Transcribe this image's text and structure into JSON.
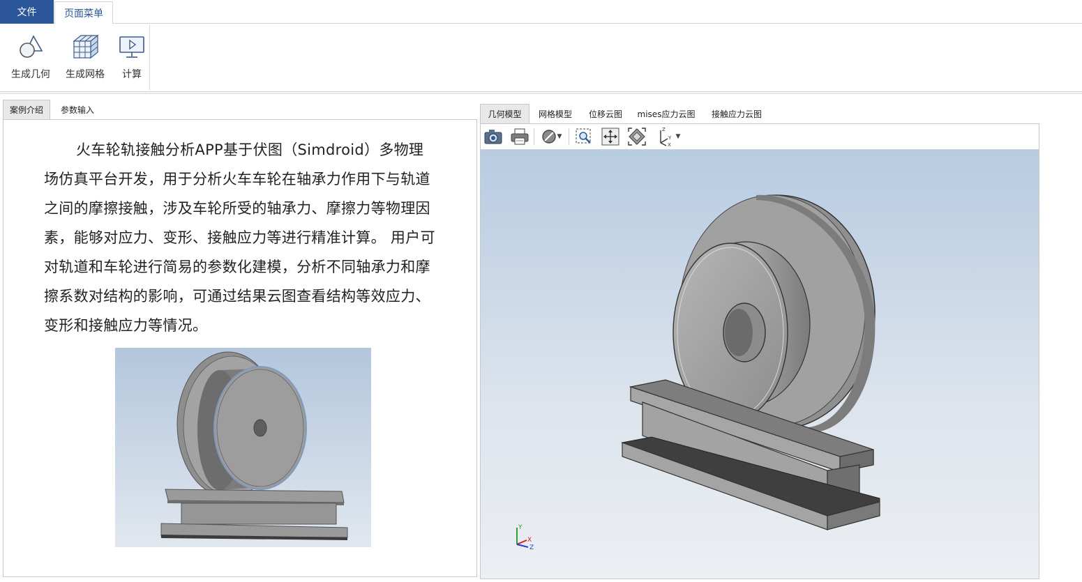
{
  "menubar": {
    "file_label": "文件",
    "page_menu_label": "页面菜单"
  },
  "ribbon": {
    "buttons": [
      {
        "label": "生成几何",
        "icon": "geometry-icon"
      },
      {
        "label": "生成网格",
        "icon": "mesh-icon"
      },
      {
        "label": "计算",
        "icon": "compute-icon"
      }
    ]
  },
  "left_tabs": [
    {
      "label": "案例介绍",
      "active": true
    },
    {
      "label": "参数输入",
      "active": false
    }
  ],
  "intro_text": "火车轮轨接触分析APP基于伏图（Simdroid）多物理场仿真平台开发，用于分析火车车轮在轴承力作用下与轨道之间的摩擦接触，涉及车轮所受的轴承力、摩擦力等物理因素，能够对应力、变形、接触应力等进行精准计算。 用户可对轨道和车轮进行简易的参数化建模，分析不同轴承力和摩擦系数对结构的影响，可通过结果云图查看结构等效应力、变形和接触应力等情况。",
  "right_tabs": [
    {
      "label": "几何模型",
      "active": true
    },
    {
      "label": "网格模型",
      "active": false
    },
    {
      "label": "位移云图",
      "active": false
    },
    {
      "label": "mises应力云图",
      "active": false
    },
    {
      "label": "接触应力云图",
      "active": false
    }
  ],
  "viewer_toolbar": {
    "icons": [
      "camera-icon",
      "print-icon",
      "render-style-icon",
      "zoom-box-icon",
      "pan-icon",
      "fit-view-icon",
      "axis-view-icon"
    ]
  },
  "axis_triad": {
    "x": "X",
    "y": "Y",
    "z": "Z"
  },
  "colors": {
    "accent": "#2b579a",
    "model_gray": "#9a9a9a",
    "viewport_top": "#b7cbe2"
  }
}
